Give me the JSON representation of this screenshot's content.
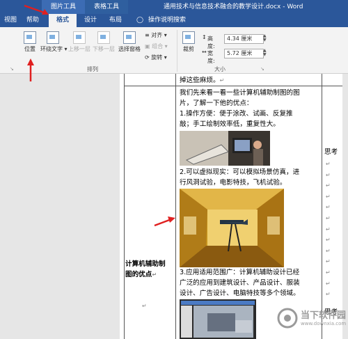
{
  "titlebar": {
    "context_picture_tools": "图片工具",
    "context_table_tools": "表格工具",
    "doc_title": "通用技术与信息技术融合的教学设计.docx - Word"
  },
  "tabs": [
    "视图",
    "帮助",
    "格式",
    "设计",
    "布局"
  ],
  "active_tab": "格式",
  "tell_me": "操作说明搜索",
  "ribbon": {
    "position": "位置",
    "wrap_text": "环绕文字",
    "bring_forward": "上移一层",
    "send_backward": "下移一层",
    "selection_pane": "选择窗格",
    "align": "对齐",
    "group": "组合",
    "rotate": "旋转",
    "arrange_label": "排列",
    "crop": "裁剪",
    "height_label": "高度:",
    "height_value": "4.34 厘米",
    "width_label": "宽度:",
    "width_value": "5.72 厘米",
    "size_label": "大小"
  },
  "document": {
    "top_line": "掉这些麻烦。",
    "intro": [
      "我们先来看一看一些计算机辅助制图的图",
      "片，了解一下他的优点：",
      "1.操作方便：便于涂改、试画、反复推",
      "敲；手工绘制效率低，重复性大。"
    ],
    "point2": [
      "2.可以虚拟现实：可以模拟场景仿真，进",
      "行风洞试验，电影特技，飞机试验。"
    ],
    "point3": [
      "3.应用适用范围广：计算机辅助设计已经",
      "广泛的应用到建筑设计、产品设计、服装",
      "设计、广告设计、电脑特技等多个领域。"
    ],
    "left_heading": [
      "计算机辅助制",
      "图的优点"
    ],
    "right_col_1": "思考",
    "right_col_2": "思考"
  },
  "watermark": {
    "name": "当下软件园",
    "domain": "www.downxia.com"
  },
  "colors": {
    "word_blue": "#2b579a",
    "annotation_red": "#e02020"
  }
}
